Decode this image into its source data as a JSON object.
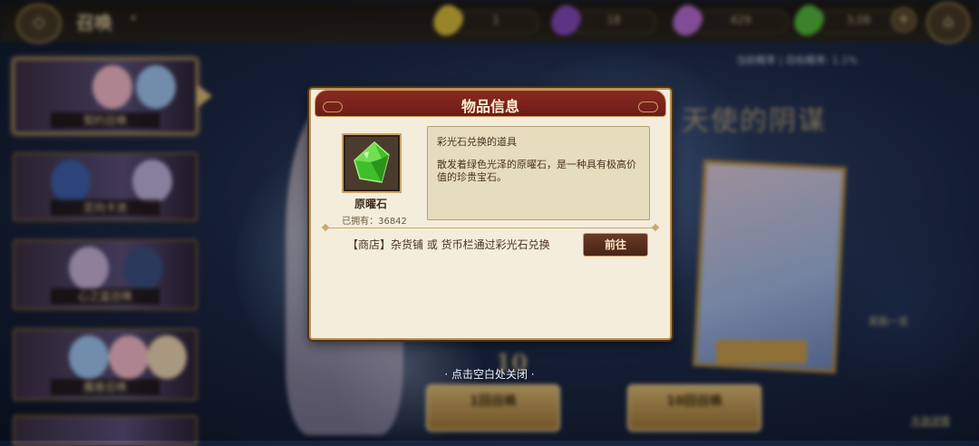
{
  "topbar": {
    "title": "召唤",
    "currencies": [
      {
        "name": "yellow-feather",
        "value": "1",
        "color": "#e5c53a"
      },
      {
        "name": "purple-feather",
        "value": "18",
        "color": "#8a4cc0"
      },
      {
        "name": "rainbow-crystal",
        "value": "429",
        "color": "#c070d8"
      },
      {
        "name": "green-crystal",
        "value": "3,08",
        "color": "#58c23a"
      }
    ],
    "plus_icon": "plus-icon",
    "home_icon": "home-icon",
    "back_icon": "back-icon"
  },
  "background": {
    "rate_text": "当前概率 | 目标概率: 1.1%",
    "sidebar_items": [
      {
        "label": "契约召唤"
      },
      {
        "label": "定向卡池"
      },
      {
        "label": "心之蓝召唤"
      },
      {
        "label": "魔兽召唤"
      }
    ],
    "banner_title": "天使的阴谋",
    "ten_pull_text": "10",
    "pull_buttons": [
      {
        "label": "1回召唤"
      },
      {
        "label": "10回召唤"
      }
    ],
    "side_info": "奖励一览",
    "bottom_link": "卡池详情"
  },
  "modal": {
    "title": "物品信息",
    "item": {
      "icon": "green-crystal-icon",
      "name": "原曜石",
      "owned_label": "已拥有：",
      "owned_count": "36842",
      "color": "#3fbf2a"
    },
    "description": {
      "title": "彩光石兑换的道具",
      "body": "散发着绿色光泽的原曜石，是一种具有极高价值的珍贵宝石。"
    },
    "source_text": "【商店】杂货铺 或 货币栏通过彩光石兑换",
    "goto_label": "前往"
  },
  "close_hint": "· 点击空白处关闭 ·"
}
